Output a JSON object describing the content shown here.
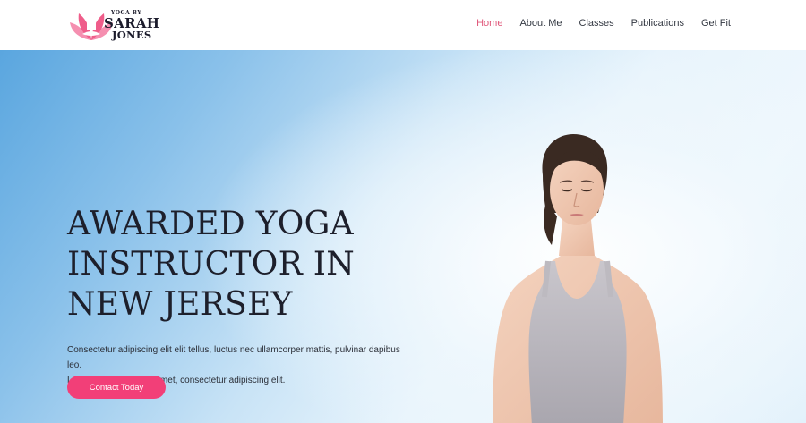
{
  "logo": {
    "line1": "YOGA BY",
    "line2": "SARAH",
    "line3": "JONES",
    "mark_color": "#ef5d8a"
  },
  "nav": {
    "items": [
      {
        "label": "Home",
        "active": true
      },
      {
        "label": "About Me",
        "active": false
      },
      {
        "label": "Classes",
        "active": false
      },
      {
        "label": "Publications",
        "active": false
      },
      {
        "label": "Get Fit",
        "active": false
      }
    ],
    "active_color": "#e0577a"
  },
  "hero": {
    "title_lines": [
      "AWARDED YOGA",
      "INSTRUCTOR IN",
      "NEW JERSEY"
    ],
    "description_lines": [
      "Consectetur adipiscing elit elit tellus, luctus nec ullamcorper mattis, pulvinar dapibus leo.",
      "Lorem ipsum dolor sit amet, consectetur adipiscing elit."
    ],
    "cta_label": "Contact Today",
    "cta_color": "#f23f78",
    "photo_subject": "meditating-woman-photo"
  }
}
